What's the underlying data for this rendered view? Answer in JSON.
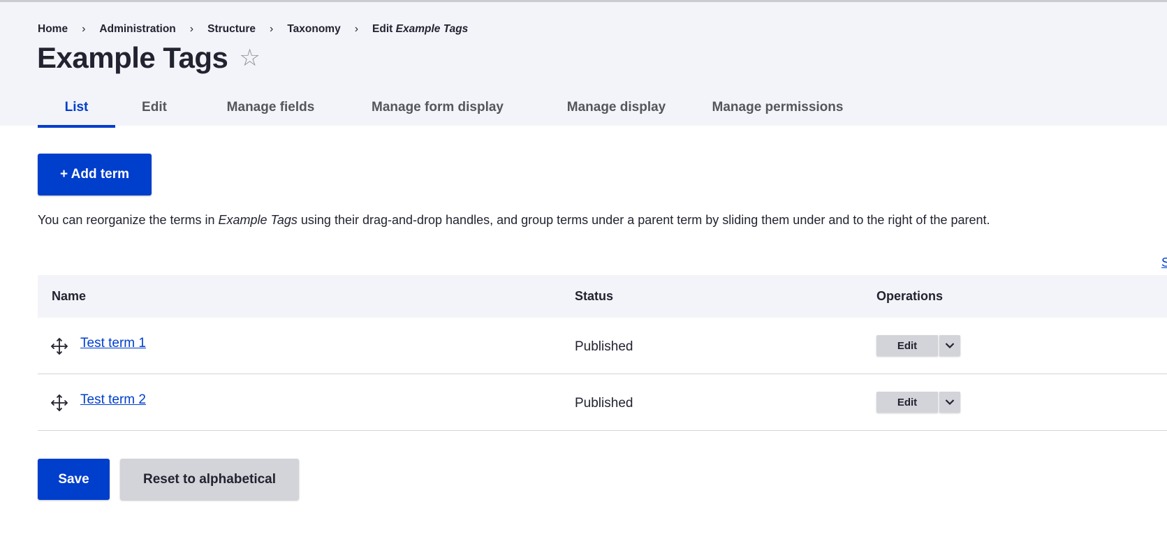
{
  "breadcrumb": {
    "items": [
      "Home",
      "Administration",
      "Structure",
      "Taxonomy"
    ],
    "current_prefix": "Edit",
    "current_name": "Example Tags",
    "separator": "›"
  },
  "page": {
    "title": "Example Tags",
    "star_icon": "☆"
  },
  "tabs": [
    {
      "label": "List",
      "active": true
    },
    {
      "label": "Edit",
      "active": false
    },
    {
      "label": "Manage fields",
      "active": false
    },
    {
      "label": "Manage form display",
      "active": false
    },
    {
      "label": "Manage display",
      "active": false
    },
    {
      "label": "Manage permissions",
      "active": false
    }
  ],
  "actions": {
    "add_term_label": "+ Add term"
  },
  "help": {
    "before": "You can reorganize the terms in ",
    "vocabulary": "Example Tags",
    "after": " using their drag-and-drop handles, and group terms under a parent term by sliding them under and to the right of the parent."
  },
  "show_weights_label": "Show row weights",
  "table": {
    "headers": {
      "name": "Name",
      "status": "Status",
      "operations": "Operations"
    },
    "rows": [
      {
        "name": "Test term 1",
        "status": "Published",
        "operation": "Edit"
      },
      {
        "name": "Test term 2",
        "status": "Published",
        "operation": "Edit"
      }
    ]
  },
  "form": {
    "save_label": "Save",
    "reset_label": "Reset to alphabetical"
  },
  "colors": {
    "primary": "#003ecc",
    "header_bg": "#f3f4f9",
    "button_gray": "#d3d4d9",
    "text": "#222330"
  },
  "icons": {
    "drag": "drag-handle-icon",
    "dropdown": "chevron-down-icon",
    "favorite": "star-icon"
  }
}
